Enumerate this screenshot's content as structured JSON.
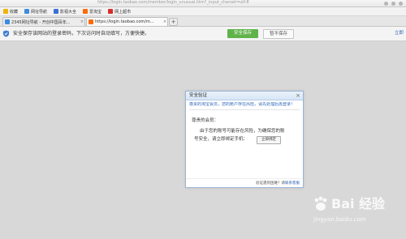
{
  "address_bar": {
    "url": "https://login.taobao.com/member/login_unusual.htm?_input_charset=utf-8"
  },
  "favorites": {
    "items": [
      {
        "label": "收藏",
        "icon": "star-icon",
        "color": "#f0b400"
      },
      {
        "label": "网址导航",
        "icon": "nav-icon",
        "color": "#3b8be0"
      },
      {
        "label": "影视大全",
        "icon": "video-icon",
        "color": "#3b6fd8"
      },
      {
        "label": "爱淘宝",
        "icon": "taobao-icon",
        "color": "#ff6a00"
      },
      {
        "label": "网上超市",
        "icon": "shop-icon",
        "color": "#d92b2b"
      }
    ]
  },
  "tabs": [
    {
      "title": "2345网址导航 - 开创中国百年...",
      "icon": "nav-favicon",
      "color": "#3b8be0"
    },
    {
      "title": "https://login.taobao.com/m...",
      "icon": "taobao-favicon",
      "color": "#ff6a00"
    }
  ],
  "new_tab_label": "+",
  "password_bar": {
    "text": "安全保存该网站的登录密码，下次访问时自动填写，方便快捷。",
    "save_label": "安全保存",
    "nosave_label": "暂不保存",
    "right_label": "立即"
  },
  "dialog": {
    "title": "安全验证",
    "close": "×",
    "subtitle": "尊贵的淘宝会员，您的账户存在风险，请先处理后再登录！",
    "greeting": "尊贵的会员：",
    "message_line1": "由于您的账号可能存在风险，为确保您的账",
    "message_line2": "号安全，请立即绑定手机：",
    "bind_button": "立即绑定",
    "footer_question": "验证遇到困难？请",
    "footer_help": "联系客服"
  },
  "watermark": {
    "text": "Bai 经验",
    "url": "jingyan.baidu.com"
  },
  "colors": {
    "accent_green": "#5fb34a",
    "link_blue": "#2a64b8",
    "background": "#d8d8d8"
  }
}
